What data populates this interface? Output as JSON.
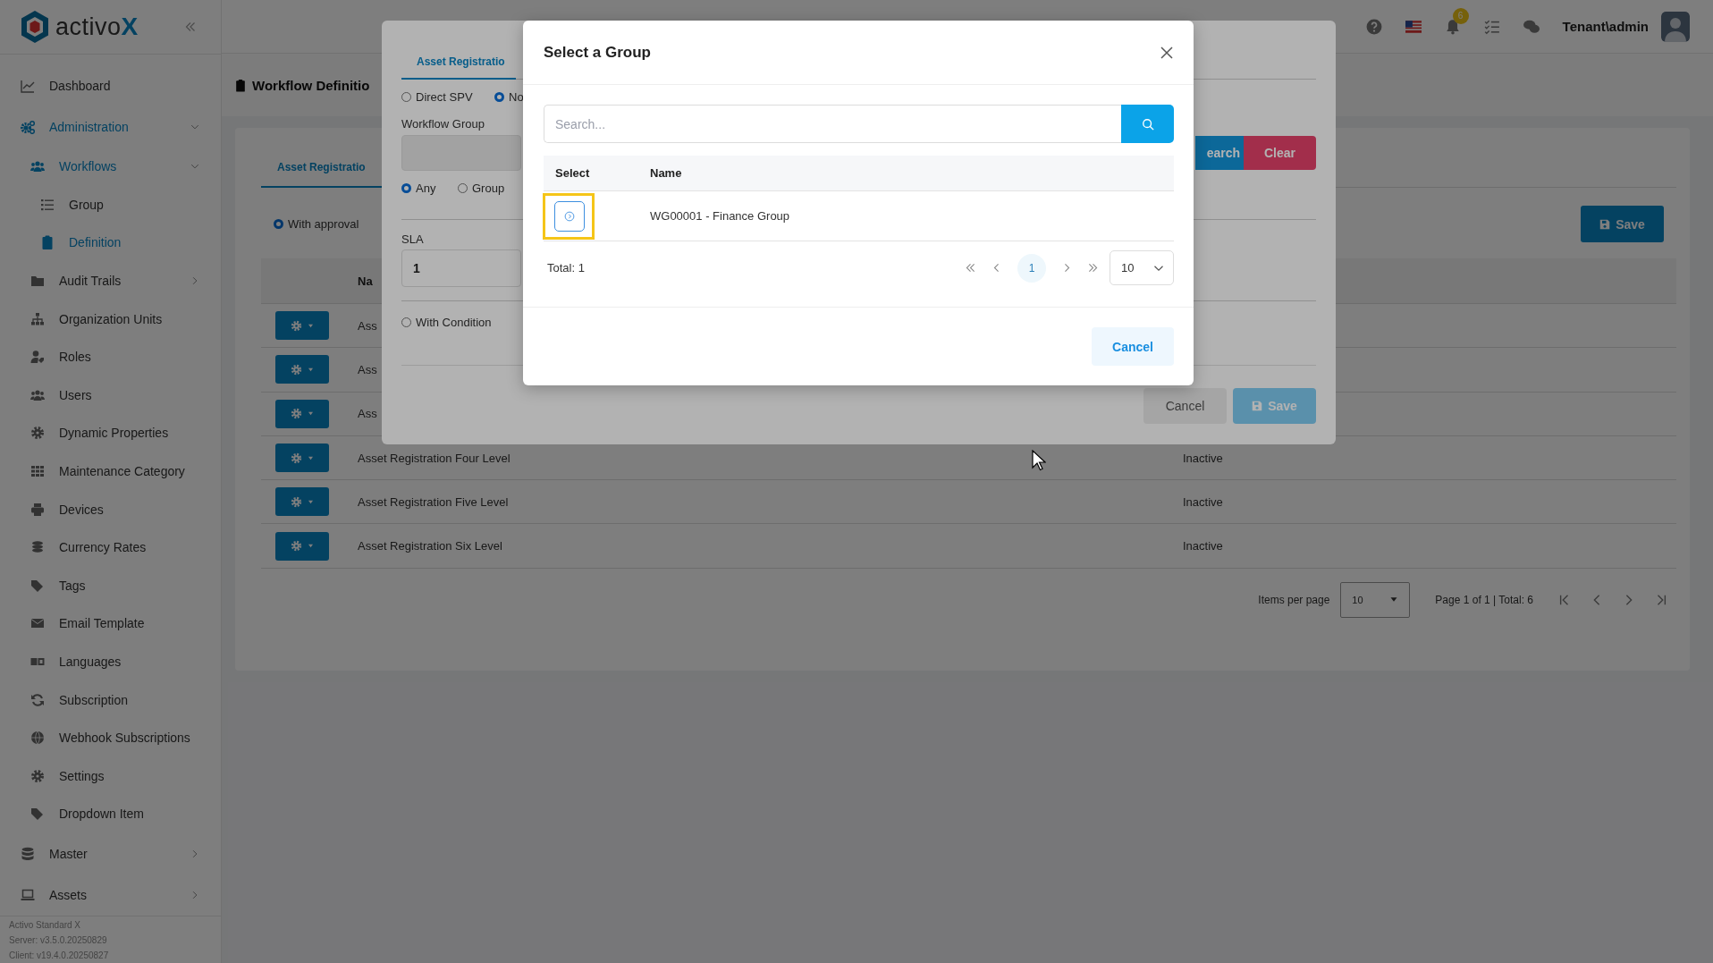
{
  "sidebar": {
    "logo": {
      "text": "activo",
      "accent": "X"
    },
    "items": [
      {
        "label": "Dashboard",
        "selected": false
      },
      {
        "label": "Administration",
        "selected": true,
        "expanded": true,
        "children": [
          {
            "label": "Workflows",
            "selected": true,
            "expanded": true,
            "children": [
              {
                "label": "Group",
                "selected": false
              },
              {
                "label": "Definition",
                "selected": true
              }
            ]
          },
          {
            "label": "Audit Trails",
            "selected": false,
            "expanded": false
          },
          {
            "label": "Organization Units",
            "selected": false
          },
          {
            "label": "Roles",
            "selected": false
          },
          {
            "label": "Users",
            "selected": false
          },
          {
            "label": "Dynamic Properties",
            "selected": false
          },
          {
            "label": "Maintenance Category",
            "selected": false
          },
          {
            "label": "Devices",
            "selected": false
          },
          {
            "label": "Currency Rates",
            "selected": false
          },
          {
            "label": "Tags",
            "selected": false
          },
          {
            "label": "Email Template",
            "selected": false
          },
          {
            "label": "Languages",
            "selected": false
          },
          {
            "label": "Subscription",
            "selected": false
          },
          {
            "label": "Webhook Subscriptions",
            "selected": false
          },
          {
            "label": "Settings",
            "selected": false
          },
          {
            "label": "Dropdown Item",
            "selected": false
          }
        ]
      },
      {
        "label": "Master",
        "selected": false,
        "expanded": false
      },
      {
        "label": "Assets",
        "selected": false,
        "expanded": false
      }
    ],
    "footer": [
      "Activo Standard X",
      "Server: v3.5.0.20250829",
      "Client: v19.4.0.20250827"
    ]
  },
  "topbar": {
    "notification_count": "6",
    "user": "Tenant\\admin"
  },
  "page": {
    "title": "Workflow Definitio",
    "tabs": [
      {
        "label": "Asset Registratio",
        "selected": true
      }
    ],
    "approval_option": {
      "label": "With approval",
      "checked": true
    },
    "save_button": "Save",
    "table": {
      "columns": [
        "Na"
      ],
      "rows": [
        {
          "name": "Ass"
        },
        {
          "name": "Ass"
        },
        {
          "name": "Ass"
        },
        {
          "name": "Asset Registration Four Level",
          "status": "Inactive"
        },
        {
          "name": "Asset Registration Five Level",
          "status": "Inactive"
        },
        {
          "name": "Asset Registration Six Level",
          "status": "Inactive"
        }
      ]
    },
    "pagination": {
      "items_per_page_label": "Items per page",
      "page_size": "10",
      "summary": "Page 1 of 1 | Total: 6"
    }
  },
  "workflow_dialog": {
    "tabs": [
      {
        "label": "Asset Registratio",
        "selected": true
      }
    ],
    "approver_options": [
      {
        "label": "Direct SPV",
        "checked": false
      },
      {
        "label": "No",
        "checked": true
      }
    ],
    "workflow_group_label": "Workflow Group",
    "search_button": "earch",
    "clear_button": "Clear",
    "match_options": [
      {
        "label": "Any",
        "checked": true
      },
      {
        "label": "Group",
        "checked": false
      }
    ],
    "sla_label": "SLA",
    "sla_value": "1",
    "condition_option": {
      "label": "With Condition",
      "checked": false
    },
    "buttons": [
      {
        "label": "Cancel",
        "kind": "secondary"
      },
      {
        "label": "Save",
        "kind": "primary"
      }
    ]
  },
  "group_modal": {
    "title": "Select a Group",
    "search": {
      "placeholder": "Search..."
    },
    "columns": [
      "Select",
      "Name"
    ],
    "rows": [
      {
        "name": "WG00001 - Finance Group",
        "highlighted": true
      }
    ],
    "total": "Total: 1",
    "pages": [
      {
        "label": "1",
        "selected": true
      }
    ],
    "page_size": "10",
    "cancel_button": "Cancel"
  }
}
